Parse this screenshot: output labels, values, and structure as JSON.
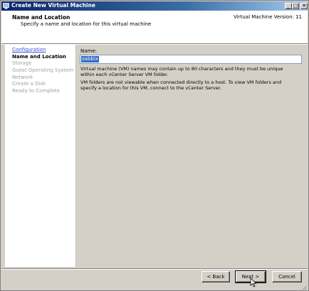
{
  "window": {
    "title": "Create New Virtual Machine",
    "controls": {
      "minimize": "_",
      "maximize": "□",
      "close": "✕"
    }
  },
  "header": {
    "title": "Name and Location",
    "subtitle": "Specify a name and location for this virtual machine",
    "version": "Virtual Machine Version: 11"
  },
  "steps": [
    {
      "label": "Configuration",
      "state": "link"
    },
    {
      "label": "Name and Location",
      "state": "current"
    },
    {
      "label": "Storage",
      "state": "pending"
    },
    {
      "label": "Guest Operating System",
      "state": "pending"
    },
    {
      "label": "Network",
      "state": "pending"
    },
    {
      "label": "Create a Disk",
      "state": "pending"
    },
    {
      "label": "Ready to Complete",
      "state": "pending"
    }
  ],
  "form": {
    "name_label": "Name:",
    "name_value": "zabbix",
    "info_1": "Virtual machine (VM) names may contain up to 80 characters and they must be unique within each vCenter Server VM folder.",
    "info_2": "VM folders are not viewable when connected directly to a host. To view VM folders and specify a location for this VM, connect to the vCenter Server."
  },
  "buttons": {
    "back": "< Back",
    "next": "Next >",
    "cancel": "Cancel"
  }
}
